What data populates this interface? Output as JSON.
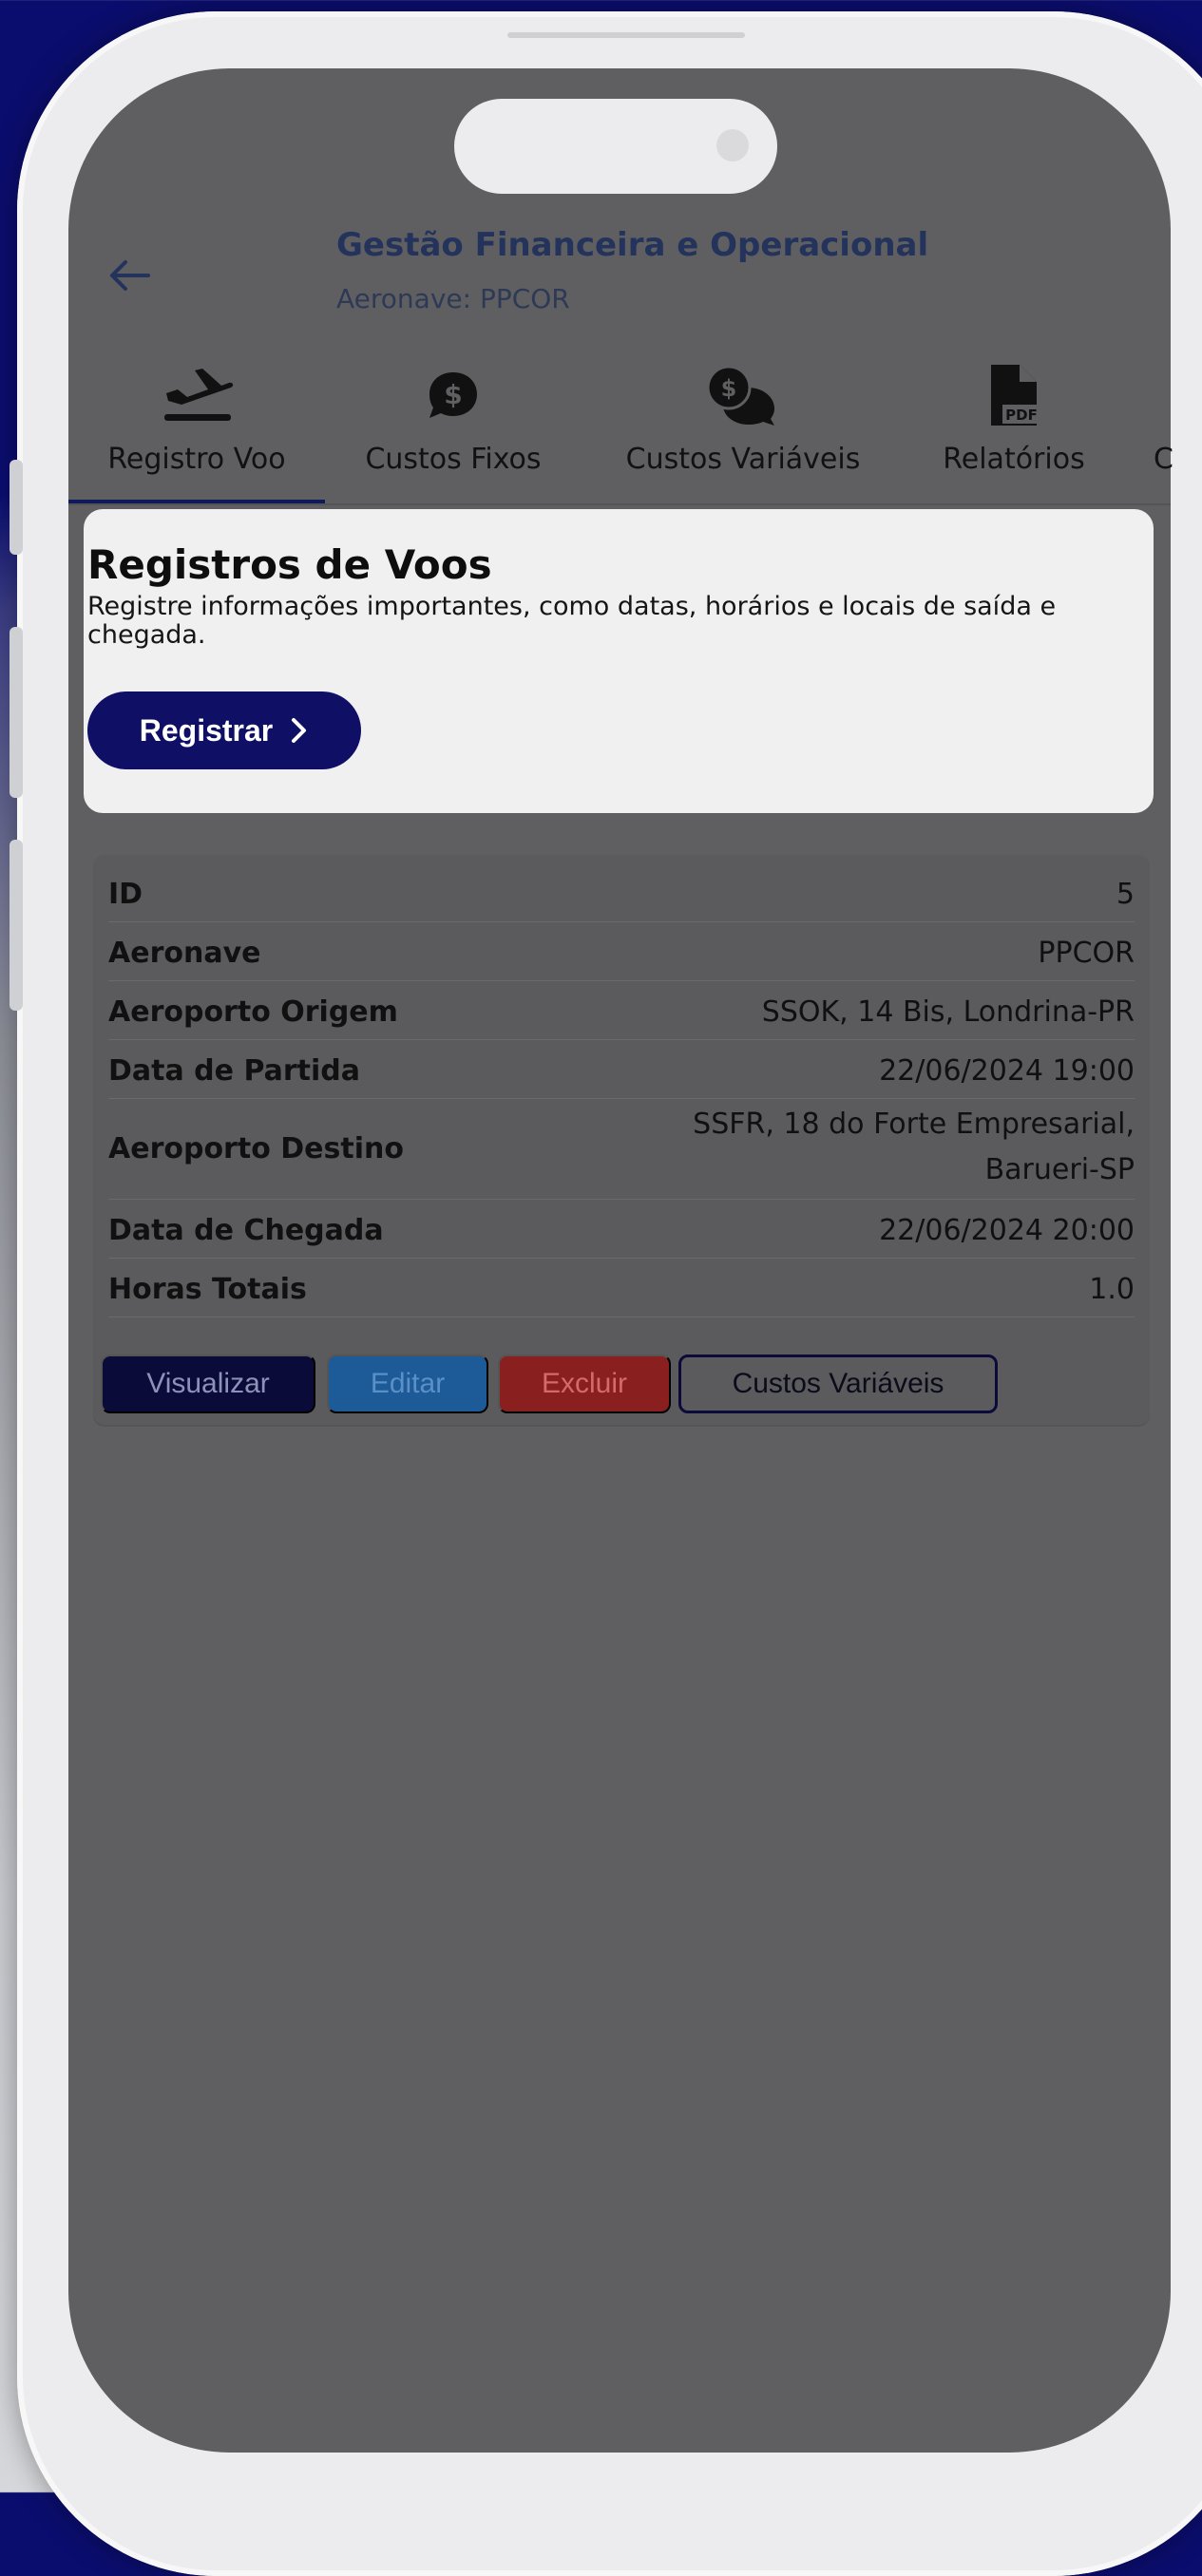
{
  "header": {
    "title": "Gestão Financeira e Operacional",
    "subtitle": "Aeronave: PPCOR"
  },
  "tabs": [
    {
      "label": "Registro Voo",
      "icon": "plane-departure-icon",
      "active": true
    },
    {
      "label": "Custos Fixos",
      "icon": "money-bubble-icon",
      "active": false
    },
    {
      "label": "Custos Variáveis",
      "icon": "money-chat-icon",
      "active": false
    },
    {
      "label": "Relatórios",
      "icon": "pdf-file-icon",
      "active": false
    }
  ],
  "tab_overflow": "C",
  "card": {
    "title": "Registros de Voos",
    "description": "Registre informações importantes, como datas, horários e locais de saída e chegada.",
    "button_label": "Registrar"
  },
  "details": [
    {
      "label": "ID",
      "value": "5"
    },
    {
      "label": "Aeronave",
      "value": "PPCOR"
    },
    {
      "label": "Aeroporto Origem",
      "value": "SSOK, 14 Bis, Londrina-PR"
    },
    {
      "label": "Data de Partida",
      "value": "22/06/2024 19:00"
    },
    {
      "label": "Aeroporto Destino",
      "value": "SSFR, 18 do Forte Empresarial,",
      "value2": "Barueri-SP"
    },
    {
      "label": "Data de Chegada",
      "value": "22/06/2024 20:00"
    },
    {
      "label": "Horas Totais",
      "value": "1.0"
    }
  ],
  "actions": {
    "view": "Visualizar",
    "edit": "Editar",
    "delete": "Excluir",
    "variable_costs": "Custos Variáveis"
  },
  "colors": {
    "background_top": "#0b0d6e",
    "screen_overlay": "#5f5f61",
    "primary": "#0f0f66",
    "edit": "#1c5b98",
    "delete": "#8a1f1f"
  }
}
